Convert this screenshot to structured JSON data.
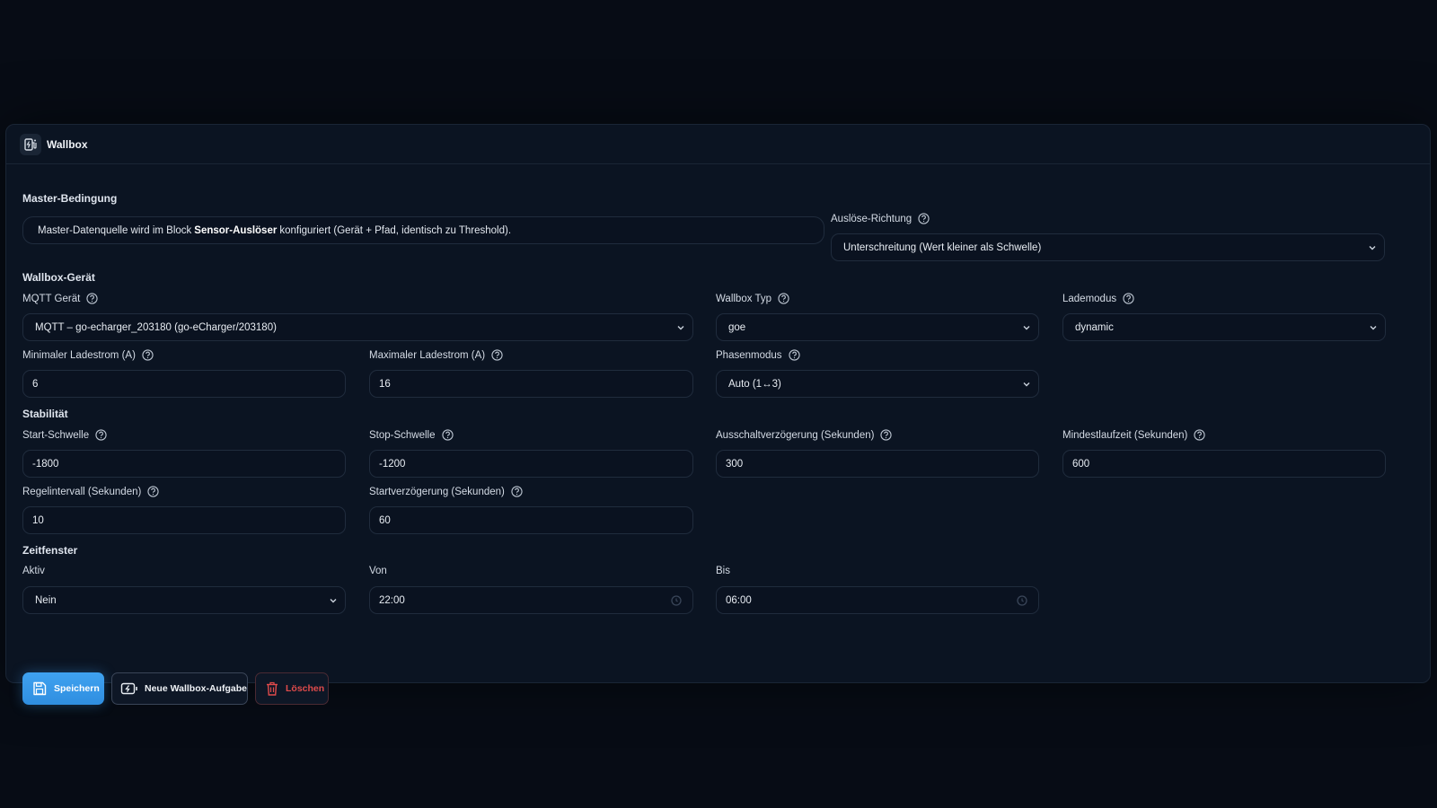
{
  "panel": {
    "title": "Wallbox"
  },
  "master": {
    "title": "Master-Bedingung",
    "info_prefix": "Master-Datenquelle wird im Block",
    "info_bold": "Sensor-Auslöser",
    "info_suffix": "konfiguriert (Gerät + Pfad, identisch zu Threshold).",
    "direction_label": "Auslöse-Richtung",
    "direction_value": "Unterschreitung (Wert kleiner als Schwelle)"
  },
  "device": {
    "title": "Wallbox-Gerät",
    "mqtt_label": "MQTT Gerät",
    "mqtt_value": "MQTT – go-echarger_203180 (go-eCharger/203180)",
    "type_label": "Wallbox Typ",
    "type_value": "goe",
    "mode_label": "Lademodus",
    "mode_value": "dynamic",
    "min_label": "Minimaler Ladestrom (A)",
    "min_value": "6",
    "max_label": "Maximaler Ladestrom (A)",
    "max_value": "16",
    "phase_label": "Phasenmodus",
    "phase_value": "Auto (1↔3)"
  },
  "stability": {
    "title": "Stabilität",
    "start_label": "Start-Schwelle",
    "start_value": "-1800",
    "stop_label": "Stop-Schwelle",
    "stop_value": "-1200",
    "off_delay_label": "Ausschaltverzögerung (Sekunden)",
    "off_delay_value": "300",
    "min_runtime_label": "Mindestlaufzeit (Sekunden)",
    "min_runtime_value": "600",
    "interval_label": "Regelintervall (Sekunden)",
    "interval_value": "10",
    "start_delay_label": "Startverzögerung (Sekunden)",
    "start_delay_value": "60"
  },
  "timewindow": {
    "title": "Zeitfenster",
    "active_label": "Aktiv",
    "active_value": "Nein",
    "from_label": "Von",
    "from_value": "22:00",
    "to_label": "Bis",
    "to_value": "06:00"
  },
  "actions": {
    "save": "Speichern",
    "new_task": "Neue Wallbox-Aufgabe",
    "delete": "Löschen"
  },
  "icons": {
    "header": "ev-charger-icon",
    "help": "question-circle-icon",
    "save": "floppy-disk-icon",
    "new_task": "charging-battery-icon",
    "delete": "trash-icon"
  },
  "colors": {
    "accent": "#3fa2f0",
    "danger": "#e04b4b",
    "background": "#070c15",
    "panel": "#0b1422"
  }
}
